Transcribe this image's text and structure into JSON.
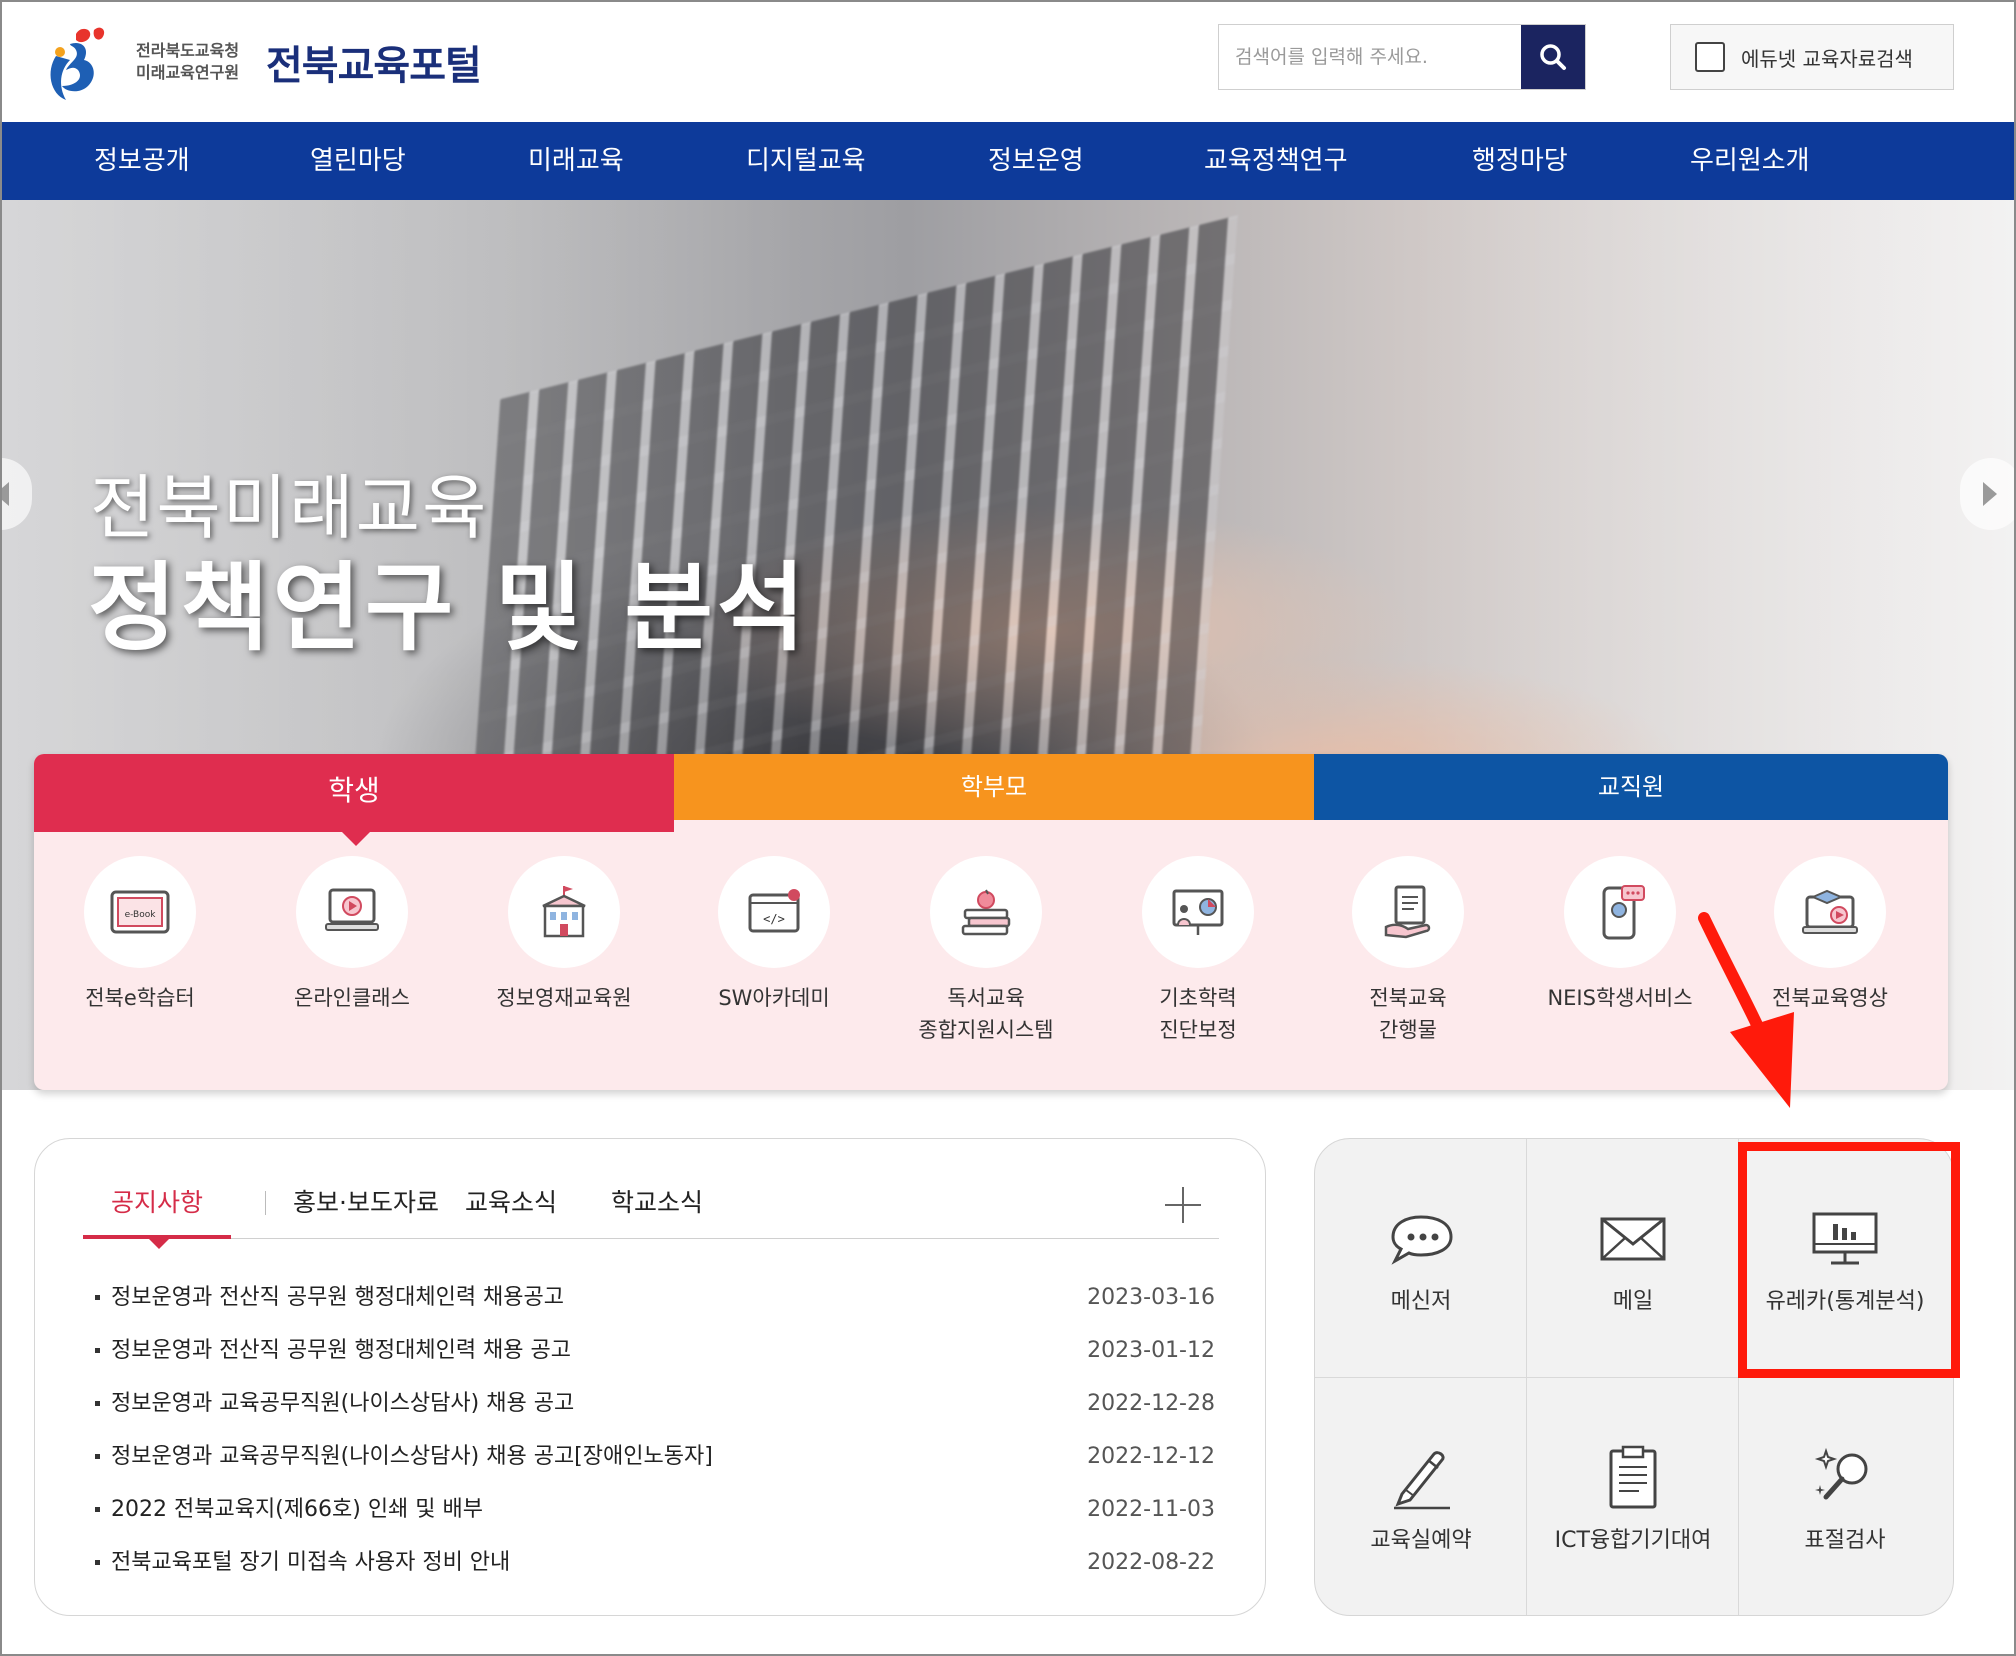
{
  "header": {
    "org_line1": "전라북도교육청",
    "org_line2": "미래교육연구원",
    "portal_title": "전북교육포털",
    "search_placeholder": "검색어를 입력해 주세요.",
    "edunet_label": "에듀넷 교육자료검색"
  },
  "nav": {
    "items": [
      {
        "label": "정보공개"
      },
      {
        "label": "열린마당"
      },
      {
        "label": "미래교육"
      },
      {
        "label": "디지털교육"
      },
      {
        "label": "정보운영"
      },
      {
        "label": "교육정책연구"
      },
      {
        "label": "행정마당"
      },
      {
        "label": "우리원소개"
      }
    ]
  },
  "hero": {
    "line1": "전북미래교육",
    "line2": "정책연구 및 분석"
  },
  "services": {
    "tabs": [
      {
        "label": "학생"
      },
      {
        "label": "학부모"
      },
      {
        "label": "교직원"
      }
    ],
    "active_tab": "학생",
    "items": [
      {
        "label": "전북e학습터",
        "icon": "ebook-icon"
      },
      {
        "label": "온라인클래스",
        "icon": "video-class-icon"
      },
      {
        "label": "정보영재교육원",
        "icon": "school-building-icon"
      },
      {
        "label": "SW아카데미",
        "icon": "code-window-icon"
      },
      {
        "label": "독서교육\n종합지원시스템",
        "icon": "books-apple-icon"
      },
      {
        "label": "기초학력\n진단보정",
        "icon": "presentation-chart-icon"
      },
      {
        "label": "전북교육\n간행물",
        "icon": "document-hand-icon"
      },
      {
        "label": "NEIS학생서비스",
        "icon": "mobile-chat-icon"
      },
      {
        "label": "전북교육영상",
        "icon": "graduation-video-icon"
      }
    ]
  },
  "notice": {
    "tabs": [
      {
        "label": "공지사항"
      },
      {
        "label": "홍보·보도자료"
      },
      {
        "label": "교육소식"
      },
      {
        "label": "학교소식"
      }
    ],
    "active_tab": "공지사항",
    "rows": [
      {
        "title": "정보운영과 전산직 공무원 행정대체인력 채용공고",
        "date": "2023-03-16"
      },
      {
        "title": "정보운영과 전산직 공무원 행정대체인력 채용 공고",
        "date": "2023-01-12"
      },
      {
        "title": "정보운영과 교육공무직원(나이스상담사) 채용 공고",
        "date": "2022-12-28"
      },
      {
        "title": "정보운영과 교육공무직원(나이스상담사) 채용 공고[장애인노동자]",
        "date": "2022-12-12"
      },
      {
        "title": "2022 전북교육지(제66호) 인쇄 및 배부",
        "date": "2022-11-03"
      },
      {
        "title": "전북교육포털 장기 미접속 사용자 정비 안내",
        "date": "2022-08-22"
      }
    ]
  },
  "quick_menu": {
    "items": [
      {
        "label": "메신저",
        "icon": "chat-bubble-icon"
      },
      {
        "label": "메일",
        "icon": "mail-icon"
      },
      {
        "label": "유레카(통계분석)",
        "icon": "monitor-chart-icon"
      },
      {
        "label": "교육실예약",
        "icon": "pencil-icon"
      },
      {
        "label": "ICT융합기기대여",
        "icon": "clipboard-icon"
      },
      {
        "label": "표절검사",
        "icon": "magnifier-sparkle-icon"
      }
    ],
    "highlighted": "유레카(통계분석)"
  },
  "colors": {
    "nav_bg": "#0d3a9a",
    "student_tab": "#df2d4f",
    "parent_tab": "#f7941e",
    "staff_tab": "#0d55a4",
    "annotation": "#ff1a0b",
    "search_button": "#1b2460"
  }
}
